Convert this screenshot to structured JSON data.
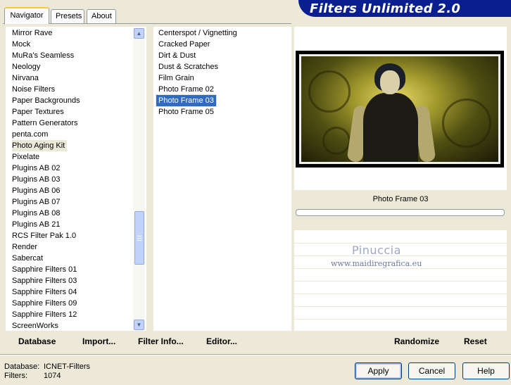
{
  "header": {
    "title": "Filters Unlimited 2.0"
  },
  "tabs": [
    {
      "label": "Navigator",
      "active": true
    },
    {
      "label": "Presets",
      "active": false
    },
    {
      "label": "About",
      "active": false
    }
  ],
  "categories": {
    "items": [
      "Mirror Rave",
      "Mock",
      "MuRa's Seamless",
      "Neology",
      "Nirvana",
      "Noise Filters",
      "Paper Backgrounds",
      "Paper Textures",
      "Pattern Generators",
      "penta.com",
      "Photo Aging Kit",
      "Pixelate",
      "Plugins AB 02",
      "Plugins AB 03",
      "Plugins AB 06",
      "Plugins AB 07",
      "Plugins AB 08",
      "Plugins AB 21",
      "RCS Filter Pak 1.0",
      "Render",
      "Sabercat",
      "Sapphire Filters 01",
      "Sapphire Filters 03",
      "Sapphire Filters 04",
      "Sapphire Filters 09",
      "Sapphire Filters 12",
      "ScreenWorks"
    ],
    "selected": "Photo Aging Kit"
  },
  "filters": {
    "items": [
      "Centerspot / Vignetting",
      "Cracked Paper",
      "Dirt & Dust",
      "Dust & Scratches",
      "Film Grain",
      "Photo Frame 02",
      "Photo Frame 03",
      "Photo Frame 05"
    ],
    "selected": "Photo Frame 03"
  },
  "preview": {
    "filter_name": "Photo Frame 03",
    "progress": 0
  },
  "watermark": {
    "name": "Pinuccia",
    "url": "www.maidiregrafica.eu"
  },
  "toolbar": {
    "database_label": "Database",
    "import_label": "Import...",
    "filter_info_label": "Filter Info...",
    "editor_label": "Editor...",
    "randomize_label": "Randomize",
    "reset_label": "Reset"
  },
  "status": {
    "database_key": "Database:",
    "database_value": "ICNET-Filters",
    "filters_key": "Filters:",
    "filters_value": "1074"
  },
  "buttons": {
    "apply": "Apply",
    "cancel": "Cancel",
    "help": "Help"
  },
  "colors": {
    "selection": "#316ac5",
    "banner": "#0a1f8f",
    "window_bg": "#ece9d8"
  }
}
